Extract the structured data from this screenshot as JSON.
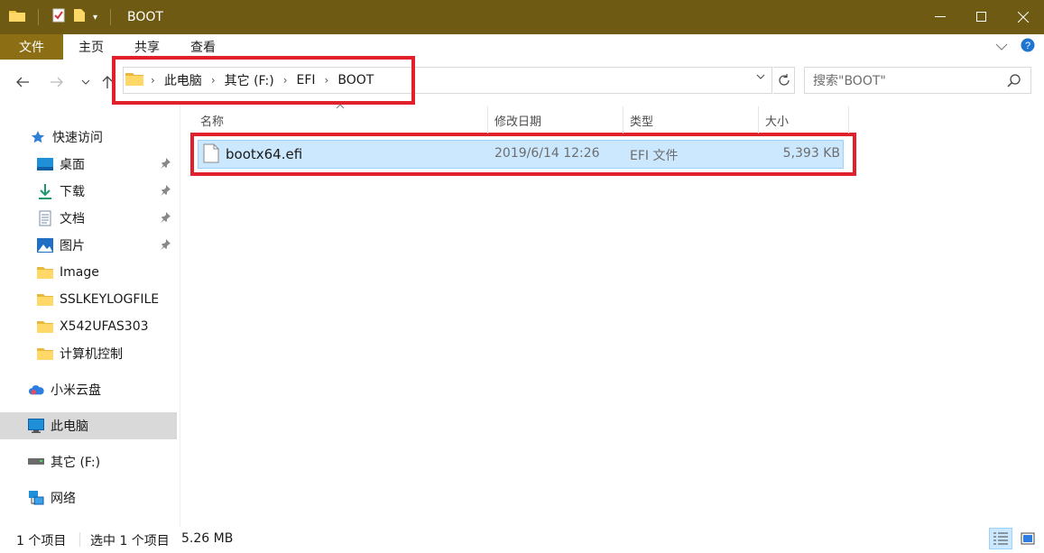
{
  "window": {
    "title": "BOOT"
  },
  "ribbon": {
    "tabs": [
      "文件",
      "主页",
      "共享",
      "查看"
    ]
  },
  "address": {
    "crumbs": [
      "此电脑",
      "其它 (F:)",
      "EFI",
      "BOOT"
    ]
  },
  "search": {
    "placeholder": "搜索\"BOOT\""
  },
  "sidebar": {
    "quick_access": "快速访问",
    "items": [
      "桌面",
      "下载",
      "文档",
      "图片",
      "Image",
      "SSLKEYLOGFILE",
      "X542UFAS303",
      "计算机控制"
    ],
    "cloud": "小米云盘",
    "this_pc": "此电脑",
    "drive": "其它 (F:)",
    "network": "网络"
  },
  "columns": {
    "name": "名称",
    "modified": "修改日期",
    "type": "类型",
    "size": "大小"
  },
  "files": [
    {
      "name": "bootx64.efi",
      "modified": "2019/6/14 12:26",
      "type": "EFI 文件",
      "size": "5,393 KB"
    }
  ],
  "status": {
    "count": "1 个项目",
    "selected": "选中 1 个项目",
    "size": "5.26 MB"
  },
  "colors": {
    "titlebar": "#6e5a12",
    "file_tab": "#8c6f15",
    "highlight": "#e0202a",
    "selection": "#cce8ff"
  }
}
